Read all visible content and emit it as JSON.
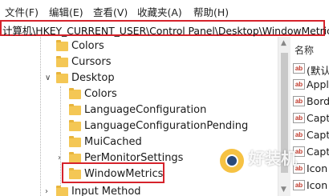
{
  "menu": {
    "items": [
      "文件(F)",
      "编辑(E)",
      "查看(V)",
      "收藏夹(A)",
      "帮助(H)"
    ]
  },
  "address": {
    "path": "计算机\\HKEY_CURRENT_USER\\Control Panel\\Desktop\\WindowMetrics"
  },
  "tree": {
    "items": [
      {
        "label": "Colors",
        "expanded": false
      },
      {
        "label": "Cursors",
        "expanded": false
      },
      {
        "label": "Desktop",
        "expanded": true
      },
      {
        "label": "Colors",
        "expanded": false
      },
      {
        "label": "LanguageConfiguration",
        "expanded": false
      },
      {
        "label": "LanguageConfigurationPending",
        "expanded": false
      },
      {
        "label": "MuiCached",
        "expanded": false
      },
      {
        "label": "PerMonitorSettings",
        "expanded": false
      },
      {
        "label": "WindowMetrics",
        "expanded": false,
        "selected": true
      },
      {
        "label": "Input Method",
        "expanded": false
      }
    ]
  },
  "values_pane": {
    "column_header": "名称",
    "entries": [
      "(默认)",
      "Appl",
      "Bord",
      "Capt",
      "Capt",
      "Capt",
      "Icon",
      "Icon"
    ]
  },
  "watermark": {
    "text": "好装机"
  },
  "colors": {
    "highlight_border": "#d6232b",
    "folder": "#f4c755"
  }
}
